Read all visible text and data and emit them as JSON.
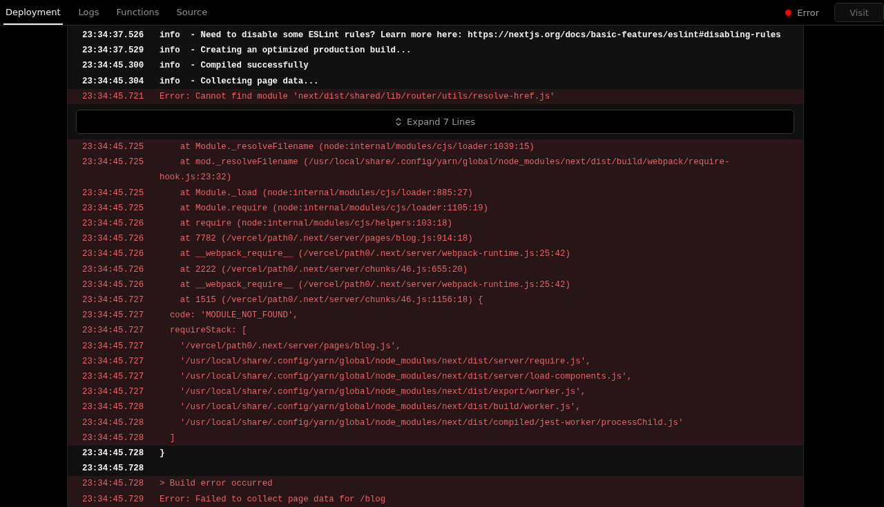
{
  "tabs": [
    {
      "label": "Deployment",
      "selected": true
    },
    {
      "label": "Logs",
      "selected": false
    },
    {
      "label": "Functions",
      "selected": false
    },
    {
      "label": "Source",
      "selected": false
    }
  ],
  "status": {
    "label": "Error",
    "color": "#ff0000"
  },
  "visit_button": {
    "label": "Visit",
    "disabled": true
  },
  "log": [
    {
      "kind": "info",
      "time": "23:34:37.526",
      "message": "info  - Need to disable some ESLint rules? Learn more here: https://nextjs.org/docs/basic-features/eslint#disabling-rules"
    },
    {
      "kind": "info",
      "time": "23:34:37.529",
      "message": "info  - Creating an optimized production build..."
    },
    {
      "kind": "info",
      "time": "23:34:45.300",
      "message": "info  - Compiled successfully"
    },
    {
      "kind": "info",
      "time": "23:34:45.304",
      "message": "info  - Collecting page data..."
    },
    {
      "kind": "error",
      "time": "23:34:45.721",
      "message": "Error: Cannot find module 'next/dist/shared/lib/router/utils/resolve-href.js'"
    },
    {
      "kind": "expand",
      "label": "Expand 7 Lines"
    },
    {
      "kind": "error",
      "time": "23:34:45.725",
      "message": "    at Module._resolveFilename (node:internal/modules/cjs/loader:1039:15)"
    },
    {
      "kind": "error",
      "time": "23:34:45.725",
      "message": "    at mod._resolveFilename (/usr/local/share/.config/yarn/global/node_modules/next/dist/build/webpack/require-hook.js:23:32)"
    },
    {
      "kind": "error",
      "time": "23:34:45.725",
      "message": "    at Module._load (node:internal/modules/cjs/loader:885:27)"
    },
    {
      "kind": "error",
      "time": "23:34:45.725",
      "message": "    at Module.require (node:internal/modules/cjs/loader:1105:19)"
    },
    {
      "kind": "error",
      "time": "23:34:45.726",
      "message": "    at require (node:internal/modules/cjs/helpers:103:18)"
    },
    {
      "kind": "error",
      "time": "23:34:45.726",
      "message": "    at 7782 (/vercel/path0/.next/server/pages/blog.js:914:18)"
    },
    {
      "kind": "error",
      "time": "23:34:45.726",
      "message": "    at __webpack_require__ (/vercel/path0/.next/server/webpack-runtime.js:25:42)"
    },
    {
      "kind": "error",
      "time": "23:34:45.726",
      "message": "    at 2222 (/vercel/path0/.next/server/chunks/46.js:655:20)"
    },
    {
      "kind": "error",
      "time": "23:34:45.726",
      "message": "    at __webpack_require__ (/vercel/path0/.next/server/webpack-runtime.js:25:42)"
    },
    {
      "kind": "error",
      "time": "23:34:45.727",
      "message": "    at 1515 (/vercel/path0/.next/server/chunks/46.js:1156:18) {"
    },
    {
      "kind": "error",
      "time": "23:34:45.727",
      "message": "  code: 'MODULE_NOT_FOUND',"
    },
    {
      "kind": "error",
      "time": "23:34:45.727",
      "message": "  requireStack: ["
    },
    {
      "kind": "error",
      "time": "23:34:45.727",
      "message": "    '/vercel/path0/.next/server/pages/blog.js',"
    },
    {
      "kind": "error",
      "time": "23:34:45.727",
      "message": "    '/usr/local/share/.config/yarn/global/node_modules/next/dist/server/require.js',"
    },
    {
      "kind": "error",
      "time": "23:34:45.727",
      "message": "    '/usr/local/share/.config/yarn/global/node_modules/next/dist/server/load-components.js',"
    },
    {
      "kind": "error",
      "time": "23:34:45.727",
      "message": "    '/usr/local/share/.config/yarn/global/node_modules/next/dist/export/worker.js',"
    },
    {
      "kind": "error",
      "time": "23:34:45.728",
      "message": "    '/usr/local/share/.config/yarn/global/node_modules/next/dist/build/worker.js',"
    },
    {
      "kind": "error",
      "time": "23:34:45.728",
      "message": "    '/usr/local/share/.config/yarn/global/node_modules/next/dist/compiled/jest-worker/processChild.js'"
    },
    {
      "kind": "error",
      "time": "23:34:45.728",
      "message": "  ]"
    },
    {
      "kind": "info",
      "time": "23:34:45.728",
      "message": "}"
    },
    {
      "kind": "info",
      "time": "23:34:45.728"
    },
    {
      "kind": "error",
      "time": "23:34:45.728",
      "message": "> Build error occurred"
    },
    {
      "kind": "error",
      "time": "23:34:45.729",
      "message": "Error: Failed to collect page data for /blog"
    }
  ]
}
